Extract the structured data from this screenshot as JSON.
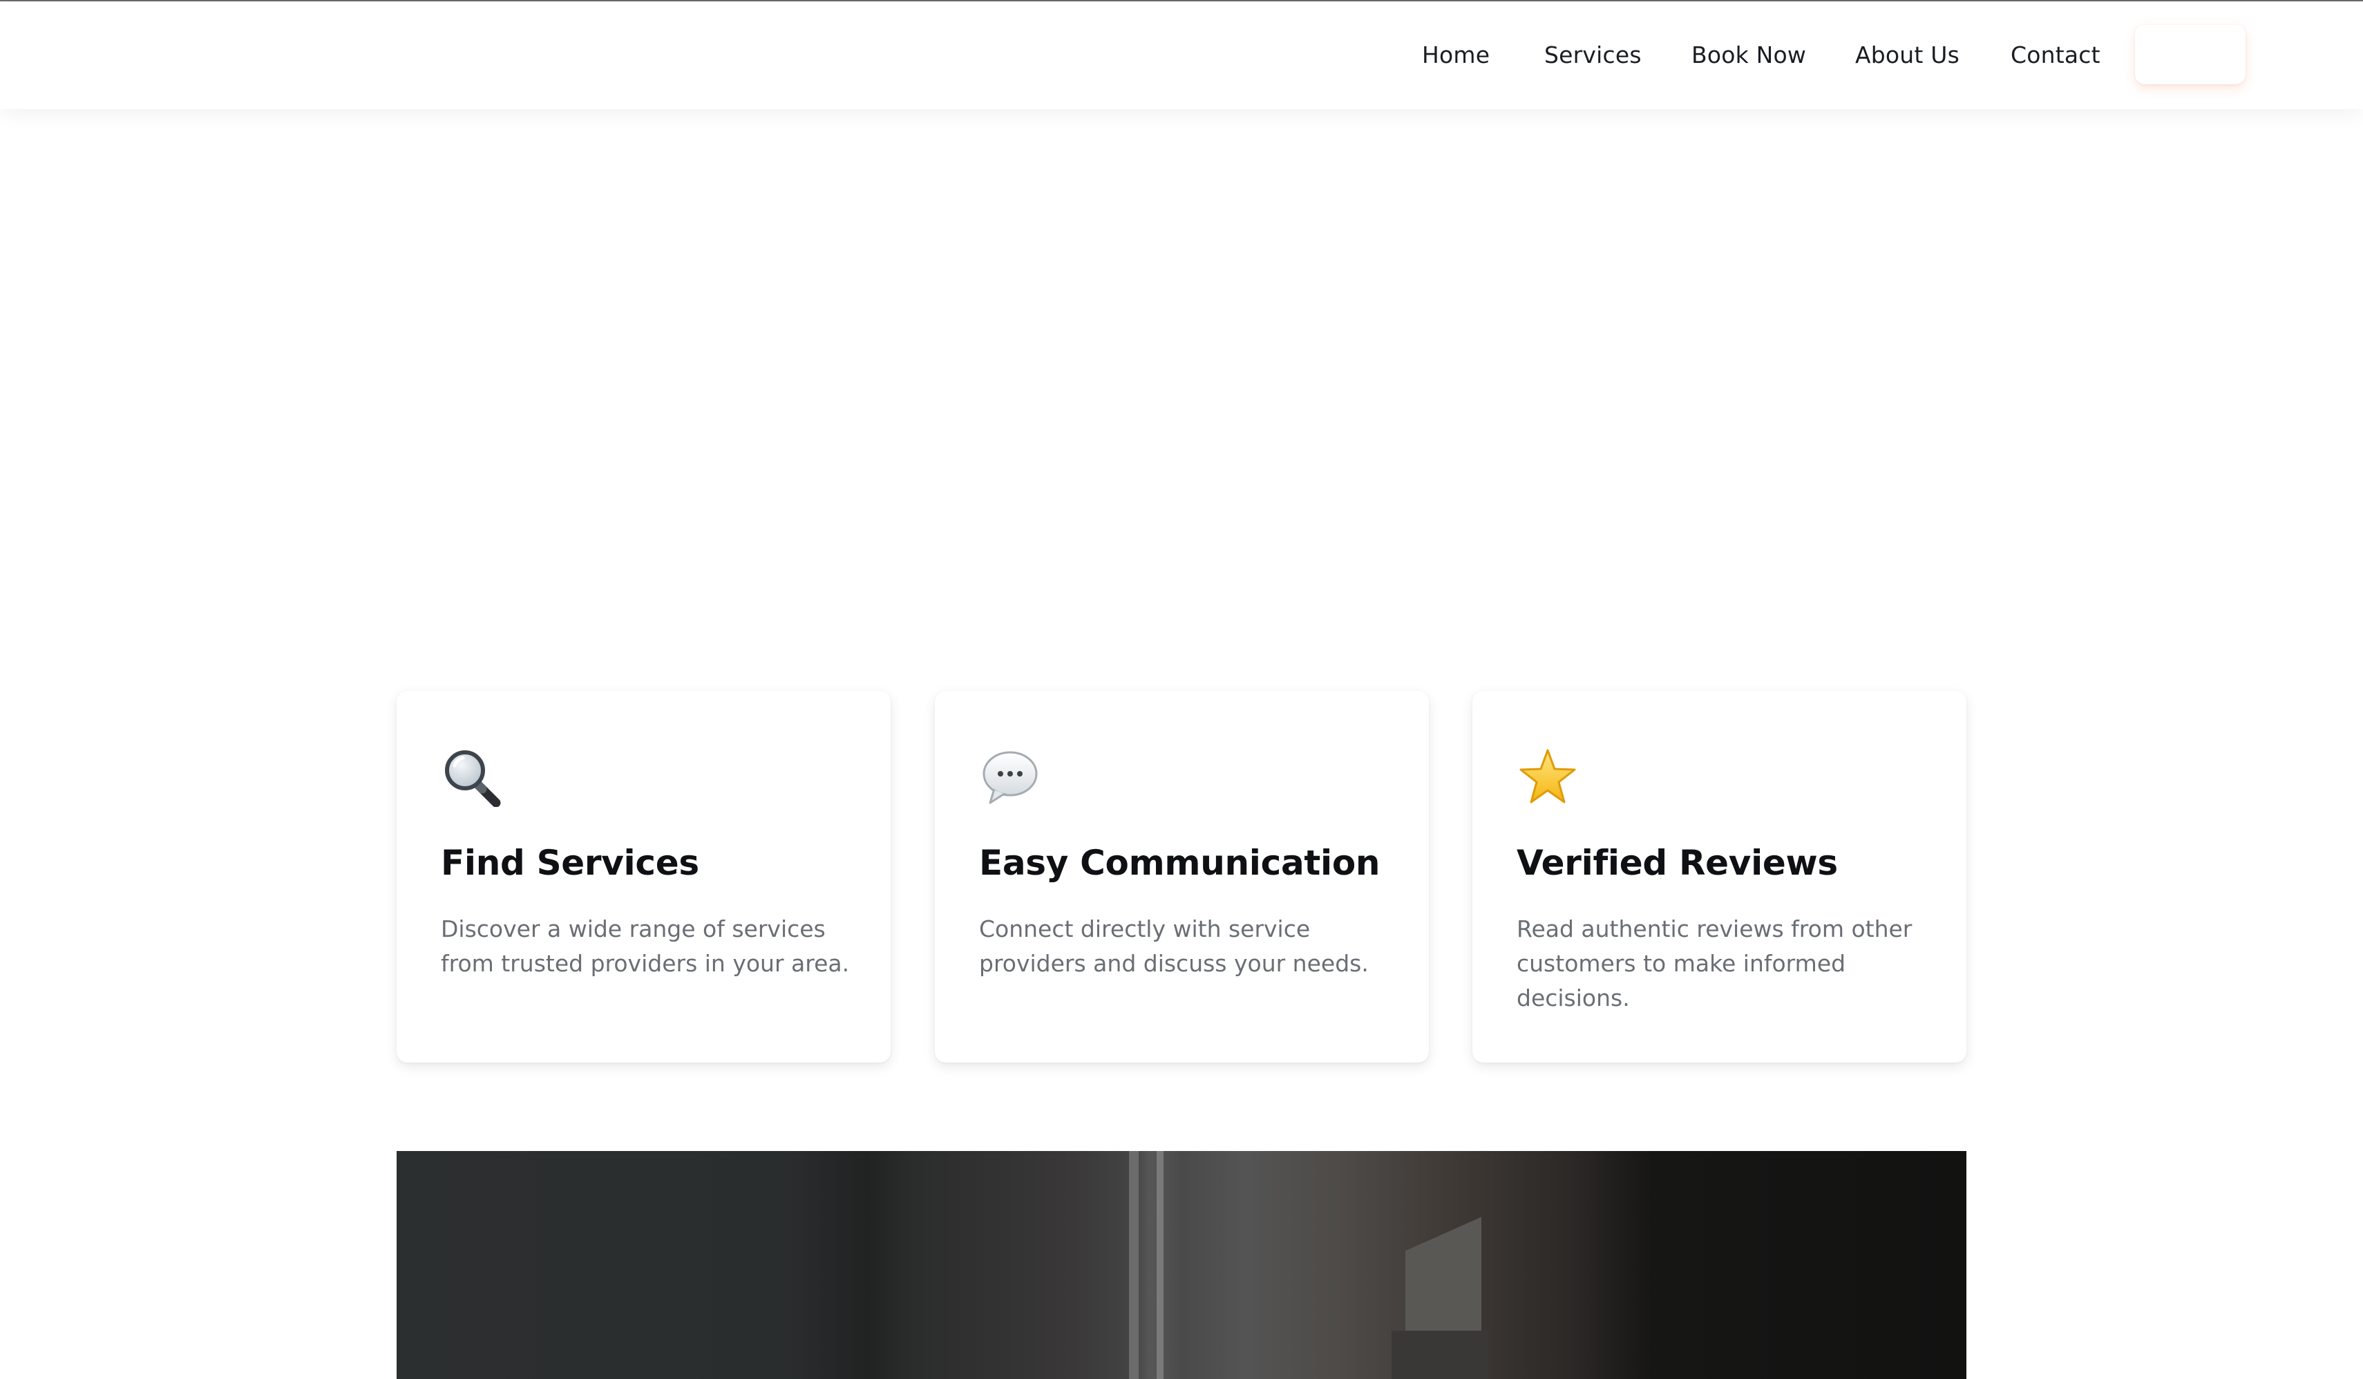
{
  "nav": {
    "links": [
      "Home",
      "Services",
      "Book Now",
      "About Us",
      "Contact"
    ],
    "cta_label": ""
  },
  "features": [
    {
      "icon": "magnifying-glass",
      "title": "Find Services",
      "description": "Discover a wide range of services from trusted providers in your area."
    },
    {
      "icon": "speech-bubble",
      "title": "Easy Communication",
      "description": "Connect directly with service providers and discuss your needs."
    },
    {
      "icon": "star",
      "title": "Verified Reviews",
      "description": "Read authentic reviews from other customers to make informed decisions."
    }
  ],
  "colors": {
    "text_primary": "#0e1014",
    "text_secondary": "#6a6e74",
    "cta_glow": "#ff783c",
    "star": "#f5c623"
  }
}
